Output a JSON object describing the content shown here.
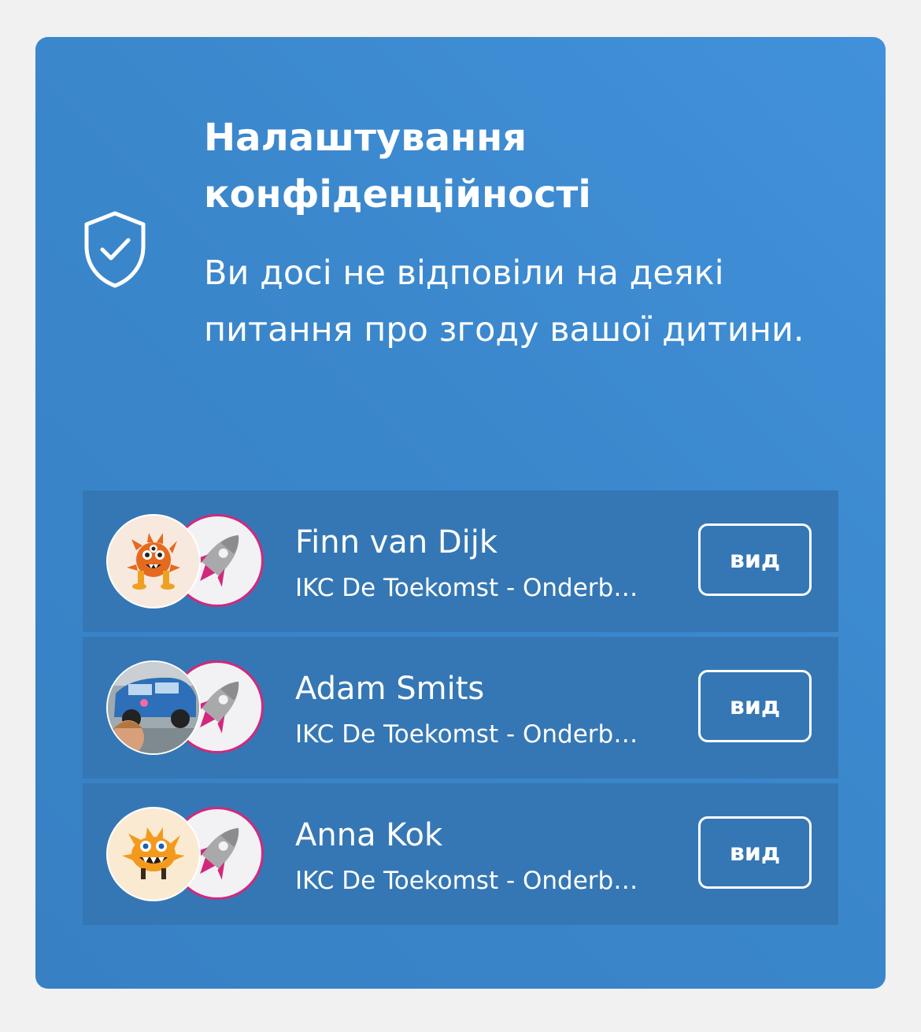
{
  "privacy_card": {
    "icon": "shield-check-icon",
    "title": "Налаштування конфіденційності",
    "description": "Ви досі не відповіли на деякі питання про згоду вашої дитини.",
    "accent_color": "#3b87cc",
    "row_color": "#3577b4",
    "group_ring_color": "#d2287c"
  },
  "children": [
    {
      "name": "Finn van Dijk",
      "school": "IKC De Toekomst - Onderbouw",
      "avatar": "orange-monster-avatar",
      "group_avatar": "rocket-icon",
      "button_label": "вид"
    },
    {
      "name": "Adam Smits",
      "school": "IKC De Toekomst - Onderbouw",
      "avatar": "photo-avatar",
      "group_avatar": "rocket-icon",
      "button_label": "вид"
    },
    {
      "name": "Anna Kok",
      "school": "IKC De Toekomst - Onderbouw",
      "avatar": "yellow-monster-avatar",
      "group_avatar": "rocket-icon",
      "button_label": "вид"
    }
  ]
}
